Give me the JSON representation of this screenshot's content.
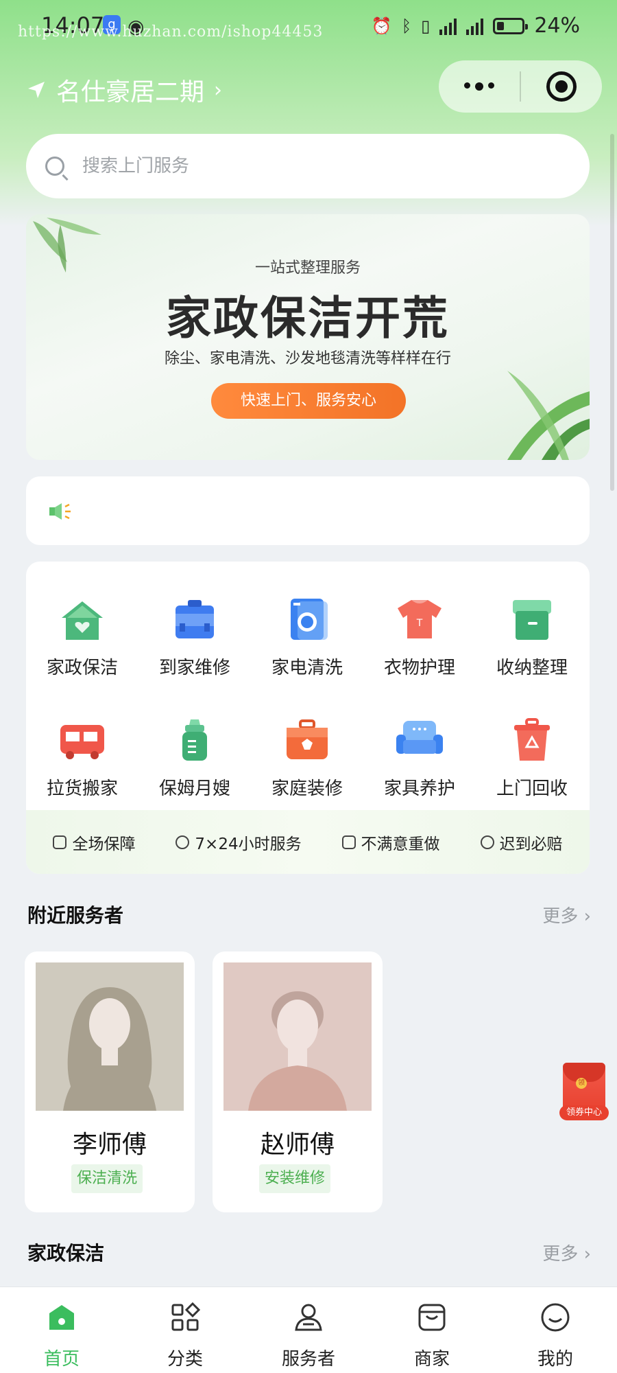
{
  "status_bar": {
    "time": "14:07",
    "watermark": "https://www.huzhan.com/ishop44453",
    "app_icon": "g",
    "battery": "24%"
  },
  "header": {
    "location": "名仕豪居二期"
  },
  "search": {
    "placeholder": "搜索上门服务"
  },
  "banner": {
    "subtitle": "一站式整理服务",
    "title": "家政保洁开荒",
    "description": "除尘、家电清洗、沙发地毯清洗等样样在行",
    "button": "快速上门、服务安心"
  },
  "categories": [
    {
      "label": "家政保洁",
      "icon": "house-heart-icon"
    },
    {
      "label": "到家维修",
      "icon": "toolbox-icon"
    },
    {
      "label": "家电清洗",
      "icon": "washing-machine-icon"
    },
    {
      "label": "衣物护理",
      "icon": "tshirt-icon"
    },
    {
      "label": "收纳整理",
      "icon": "storage-box-icon"
    },
    {
      "label": "拉货搬家",
      "icon": "truck-icon"
    },
    {
      "label": "保姆月嫂",
      "icon": "baby-bottle-icon"
    },
    {
      "label": "家庭装修",
      "icon": "toolkit-icon"
    },
    {
      "label": "家具养护",
      "icon": "sofa-icon"
    },
    {
      "label": "上门回收",
      "icon": "recycle-bin-icon"
    }
  ],
  "guarantees": [
    {
      "label": "全场保障",
      "icon": "shield-icon"
    },
    {
      "label": "7×24小时服务",
      "icon": "clock-icon"
    },
    {
      "label": "不满意重做",
      "icon": "document-icon"
    },
    {
      "label": "迟到必赔",
      "icon": "coin-icon"
    }
  ],
  "nearby": {
    "title": "附近服务者",
    "more": "更多",
    "workers": [
      {
        "name": "李师傅",
        "tag": "保洁清洗"
      },
      {
        "name": "赵师傅",
        "tag": "安装维修"
      }
    ]
  },
  "housekeeping": {
    "title": "家政保洁",
    "more": "更多"
  },
  "coupon": {
    "seal": "领",
    "label": "领券中心"
  },
  "tabbar": [
    {
      "label": "首页",
      "icon": "home-icon",
      "active": true
    },
    {
      "label": "分类",
      "icon": "category-icon",
      "active": false
    },
    {
      "label": "服务者",
      "icon": "worker-icon",
      "active": false
    },
    {
      "label": "商家",
      "icon": "shop-icon",
      "active": false
    },
    {
      "label": "我的",
      "icon": "smile-icon",
      "active": false
    }
  ],
  "colors": {
    "accent_green": "#3bbd5e",
    "header_green": "#8fe08a",
    "orange_button": "#f37327"
  }
}
